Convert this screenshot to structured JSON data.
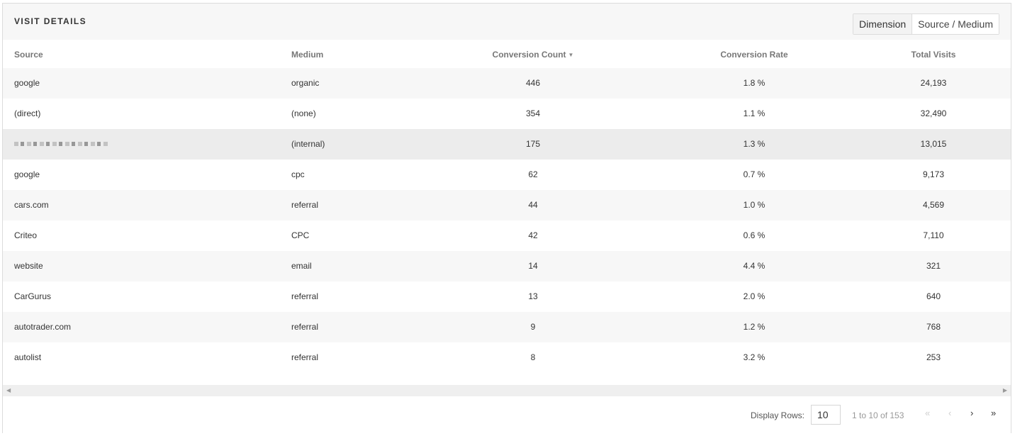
{
  "panel": {
    "title": "VISIT DETAILS",
    "dimension_label": "Dimension",
    "dimension_value": "Source / Medium"
  },
  "table": {
    "columns": {
      "source": "Source",
      "medium": "Medium",
      "conversion_count": "Conversion Count",
      "conversion_rate": "Conversion Rate",
      "total_visits": "Total Visits"
    },
    "sort_icon": "chevron-down-icon",
    "rows": [
      {
        "source": "google",
        "medium": "organic",
        "count": "446",
        "rate": "1.8 %",
        "visits": "24,193"
      },
      {
        "source": "(direct)",
        "medium": "(none)",
        "count": "354",
        "rate": "1.1 %",
        "visits": "32,490"
      },
      {
        "source": "",
        "source_redacted": true,
        "medium": "(internal)",
        "count": "175",
        "rate": "1.3 %",
        "visits": "13,015"
      },
      {
        "source": "google",
        "medium": "cpc",
        "count": "62",
        "rate": "0.7 %",
        "visits": "9,173"
      },
      {
        "source": "cars.com",
        "medium": "referral",
        "count": "44",
        "rate": "1.0 %",
        "visits": "4,569"
      },
      {
        "source": "Criteo",
        "medium": "CPC",
        "count": "42",
        "rate": "0.6 %",
        "visits": "7,110"
      },
      {
        "source": "website",
        "medium": "email",
        "count": "14",
        "rate": "4.4 %",
        "visits": "321"
      },
      {
        "source": "CarGurus",
        "medium": "referral",
        "count": "13",
        "rate": "2.0 %",
        "visits": "640"
      },
      {
        "source": "autotrader.com",
        "medium": "referral",
        "count": "9",
        "rate": "1.2 %",
        "visits": "768"
      },
      {
        "source": "autolist",
        "medium": "referral",
        "count": "8",
        "rate": "3.2 %",
        "visits": "253"
      }
    ]
  },
  "footer": {
    "display_rows_label": "Display Rows:",
    "display_rows_value": "10",
    "page_info": "1 to 10 of 153",
    "first": "«",
    "prev": "‹",
    "next": "›",
    "last": "»"
  },
  "colors": {
    "header_bg": "#f7f7f7",
    "row_alt": "#f7f7f7",
    "row_hover": "#ececec",
    "muted_text": "#999999"
  }
}
